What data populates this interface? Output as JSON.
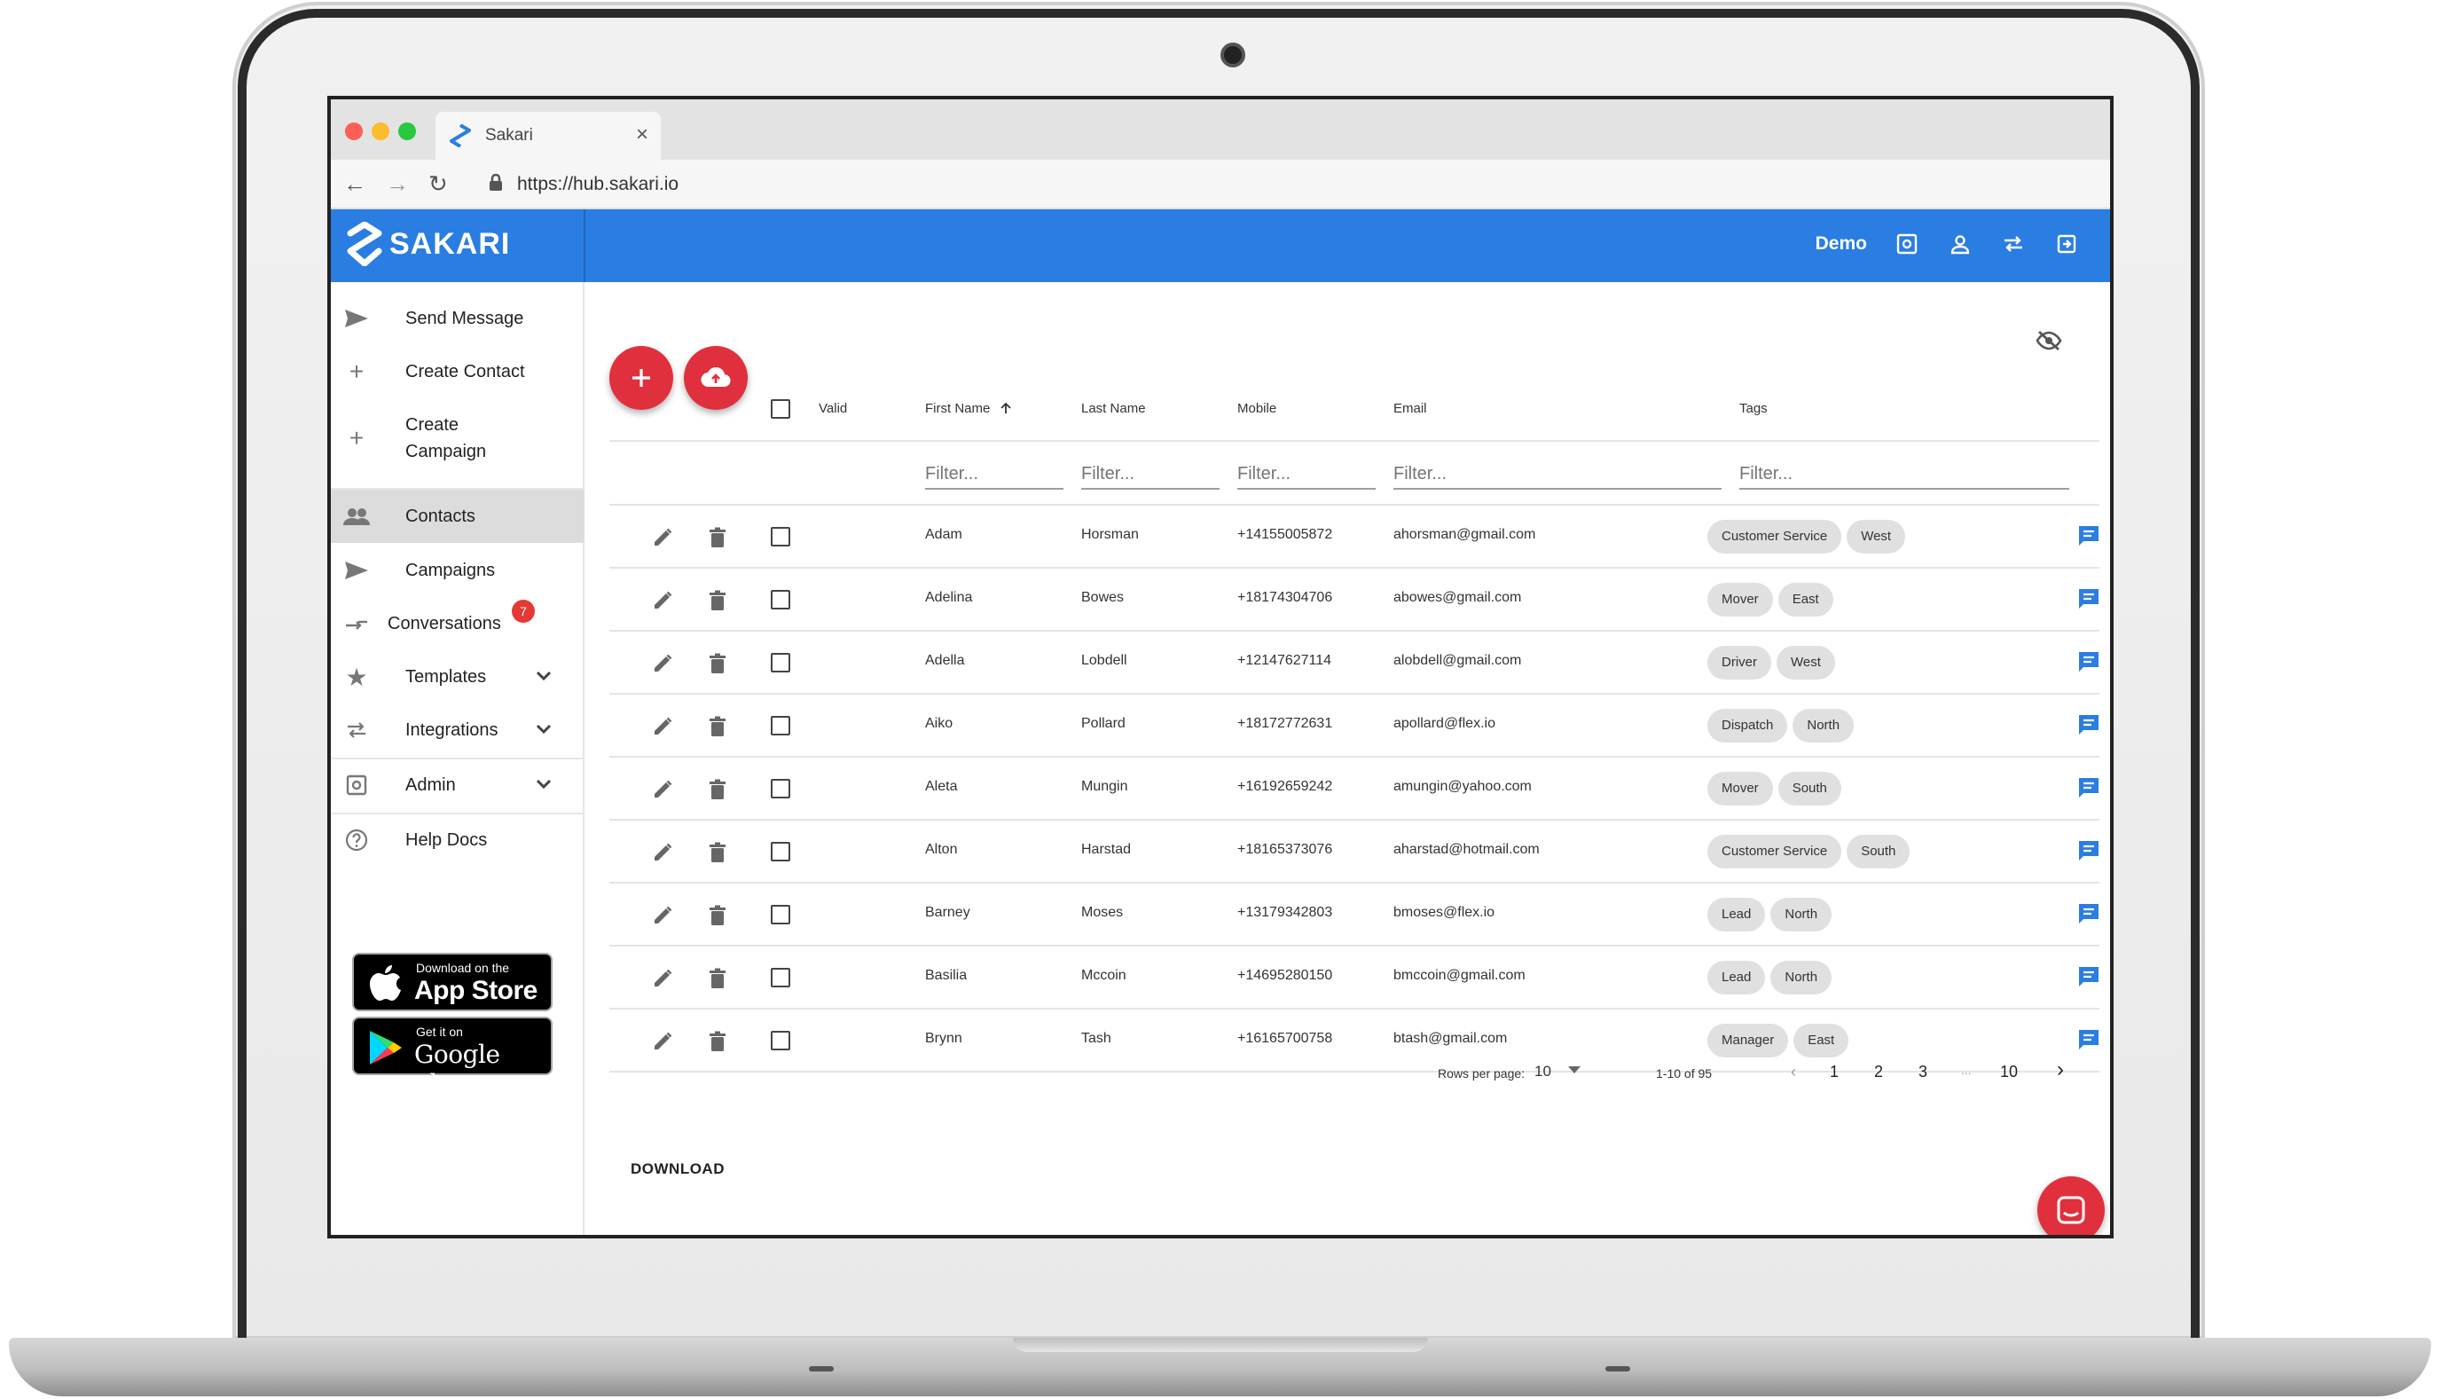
{
  "browser": {
    "tab_title": "Sakari",
    "url": "https://hub.sakari.io"
  },
  "header": {
    "brand": "SAKARI",
    "account_name": "Demo",
    "accent_color": "#2a7de1"
  },
  "sidebar": {
    "items": [
      {
        "label": "Send Message",
        "icon": "send-icon"
      },
      {
        "label": "Create Contact",
        "icon": "plus-icon"
      },
      {
        "label": "Create Campaign",
        "icon": "plus-icon"
      },
      {
        "label": "Contacts",
        "icon": "people-icon",
        "active": true
      },
      {
        "label": "Campaigns",
        "icon": "send-icon"
      },
      {
        "label": "Conversations",
        "icon": "swap-icon",
        "badge": "7"
      },
      {
        "label": "Templates",
        "icon": "star-icon",
        "expandable": true
      },
      {
        "label": "Integrations",
        "icon": "swap-icon",
        "expandable": true
      },
      {
        "label": "Admin",
        "icon": "gear-icon",
        "expandable": true
      },
      {
        "label": "Help Docs",
        "icon": "help-icon"
      }
    ],
    "app_store": {
      "small": "Download on the",
      "big": "App Store"
    },
    "google_play": {
      "small": "Get it on",
      "big": "Google play"
    }
  },
  "table": {
    "columns": {
      "valid": "Valid",
      "first_name": "First Name",
      "last_name": "Last Name",
      "mobile": "Mobile",
      "email": "Email",
      "tags": "Tags"
    },
    "filter_placeholder": "Filter...",
    "rows": [
      {
        "first": "Adam",
        "last": "Horsman",
        "mobile": "+14155005872",
        "email": "ahorsman@gmail.com",
        "tags": [
          "Customer Service",
          "West"
        ]
      },
      {
        "first": "Adelina",
        "last": "Bowes",
        "mobile": "+18174304706",
        "email": "abowes@gmail.com",
        "tags": [
          "Mover",
          "East"
        ]
      },
      {
        "first": "Adella",
        "last": "Lobdell",
        "mobile": "+12147627114",
        "email": "alobdell@gmail.com",
        "tags": [
          "Driver",
          "West"
        ]
      },
      {
        "first": "Aiko",
        "last": "Pollard",
        "mobile": "+18172772631",
        "email": "apollard@flex.io",
        "tags": [
          "Dispatch",
          "North"
        ]
      },
      {
        "first": "Aleta",
        "last": "Mungin",
        "mobile": "+16192659242",
        "email": "amungin@yahoo.com",
        "tags": [
          "Mover",
          "South"
        ]
      },
      {
        "first": "Alton",
        "last": "Harstad",
        "mobile": "+18165373076",
        "email": "aharstad@hotmail.com",
        "tags": [
          "Customer Service",
          "South"
        ]
      },
      {
        "first": "Barney",
        "last": "Moses",
        "mobile": "+13179342803",
        "email": "bmoses@flex.io",
        "tags": [
          "Lead",
          "North"
        ]
      },
      {
        "first": "Basilia",
        "last": "Mccoin",
        "mobile": "+14695280150",
        "email": "bmccoin@gmail.com",
        "tags": [
          "Lead",
          "North"
        ]
      },
      {
        "first": "Brynn",
        "last": "Tash",
        "mobile": "+16165700758",
        "email": "btash@gmail.com",
        "tags": [
          "Manager",
          "East"
        ]
      }
    ]
  },
  "pagination": {
    "rows_per_page_label": "Rows per page:",
    "rows_per_page": "10",
    "range": "1-10 of 95",
    "pages": [
      "1",
      "2",
      "3",
      "...",
      "10"
    ]
  },
  "download_label": "DOWNLOAD"
}
